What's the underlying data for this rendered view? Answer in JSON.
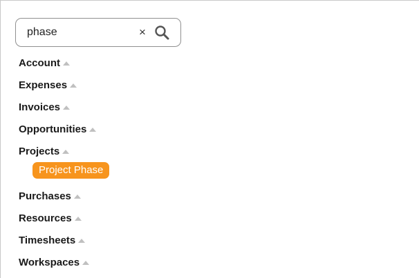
{
  "search": {
    "value": "phase",
    "clear_symbol": "×"
  },
  "categories": [
    {
      "label": "Account"
    },
    {
      "label": "Expenses"
    },
    {
      "label": "Invoices"
    },
    {
      "label": "Opportunities"
    },
    {
      "label": "Projects",
      "children": [
        {
          "label": "Project Phase"
        }
      ]
    },
    {
      "label": "Purchases"
    },
    {
      "label": "Resources"
    },
    {
      "label": "Timesheets"
    },
    {
      "label": "Workspaces"
    }
  ],
  "colors": {
    "highlight": "#f7941d",
    "caret": "#c0c0c0",
    "border": "#8f8f8f"
  },
  "icons": [
    "clear-icon",
    "search-icon",
    "caret-up-icon"
  ]
}
